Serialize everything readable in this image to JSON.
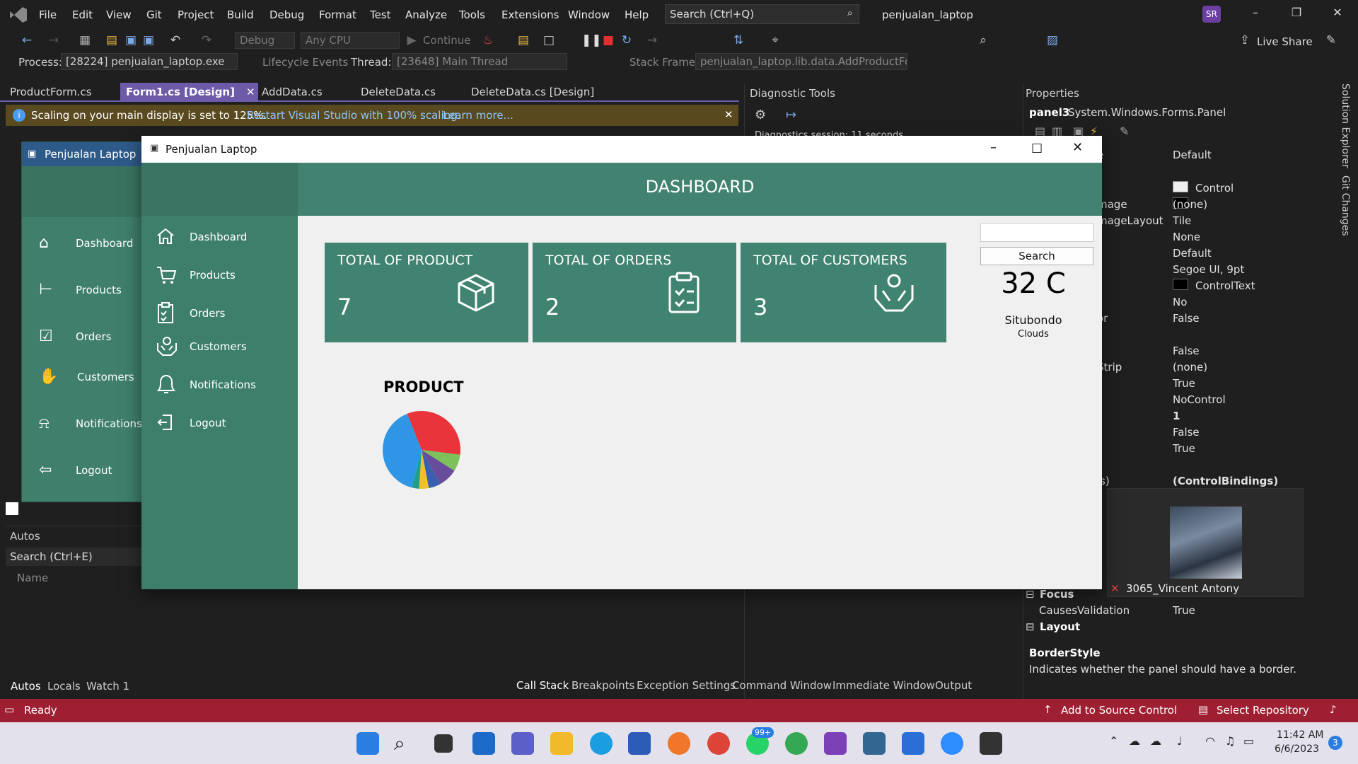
{
  "vs": {
    "menu": [
      "File",
      "Edit",
      "View",
      "Git",
      "Project",
      "Build",
      "Debug",
      "Format",
      "Test",
      "Analyze",
      "Tools",
      "Extensions",
      "Window",
      "Help"
    ],
    "search_placeholder": "Search (Ctrl+Q)",
    "project_title": "penjualan_laptop",
    "avatar_initials": "SR",
    "toolbar": {
      "config": "Debug",
      "platform": "Any CPU",
      "continue": "Continue",
      "live_share": "Live Share"
    },
    "process_bar": {
      "process_label": "Process:",
      "process_value": "[28224] penjualan_laptop.exe",
      "lifecycle": "Lifecycle Events",
      "thread_label": "Thread:",
      "thread_value": "[23648] Main Thread",
      "stack_label": "Stack Frame:",
      "stack_value": "penjualan_laptop.lib.data.AddProductForr"
    },
    "tabs": [
      "ProductForm.cs",
      "Form1.cs [Design]",
      "AddData.cs",
      "DeleteData.cs",
      "DeleteData.cs [Design]"
    ],
    "info_bar": {
      "message": "Scaling on your main display is set to 125%.",
      "link1": "Restart Visual Studio with 100% scaling.",
      "link2": "Learn more..."
    },
    "diagnostic": {
      "title": "Diagnostic Tools",
      "session": "Diagnostics session: 11 seconds"
    },
    "properties": {
      "title": "Properties",
      "object": "panel3",
      "type": "System.Windows.Forms.Panel",
      "rows": [
        {
          "name": "e",
          "value": "Default"
        },
        {
          "name": "",
          "value": "Control"
        },
        {
          "name": "mage",
          "value": "(none)"
        },
        {
          "name": "mageLayout",
          "value": "Tile"
        },
        {
          "name": "",
          "value": "None"
        },
        {
          "name": "",
          "value": "Default"
        },
        {
          "name": "",
          "value": "Segoe UI, 9pt"
        },
        {
          "name": "",
          "value": "ControlText"
        },
        {
          "name": "",
          "value": "No"
        },
        {
          "name": "or",
          "value": "False"
        },
        {
          "name": "",
          "value": "False"
        },
        {
          "name": "Strip",
          "value": "(none)"
        },
        {
          "name": "",
          "value": "True"
        },
        {
          "name": "",
          "value": "NoControl"
        },
        {
          "name": "",
          "value": "1"
        },
        {
          "name": "",
          "value": "False"
        },
        {
          "name": "",
          "value": "True"
        },
        {
          "name": "s)",
          "value": "(ControlBindings)"
        }
      ],
      "section_focus": "Focus",
      "causes_validation_label": "CausesValidation",
      "causes_validation_value": "True",
      "section_layout": "Layout",
      "help_title": "BorderStyle",
      "help_text": "Indicates whether the panel should have a border."
    },
    "side_tabs": [
      "Solution Explorer",
      "Git Changes"
    ],
    "autos": {
      "title": "Autos",
      "search": "Search (Ctrl+E)",
      "col_name": "Name",
      "bottom_tabs": [
        "Autos",
        "Locals",
        "Watch 1"
      ]
    },
    "bottom_tabs_right": [
      "Call Stack",
      "Breakpoints",
      "Exception Settings",
      "Command Window",
      "Immediate Window",
      "Output"
    ],
    "status": {
      "ready": "Ready",
      "source_control": "Add to Source Control",
      "repo": "Select Repository"
    },
    "zoom_tooltip_name": "3065_Vincent Antony"
  },
  "designer_form": {
    "title": "Penjualan Laptop",
    "nav": [
      "Dashboard",
      "Products",
      "Orders",
      "Customers",
      "Notifications",
      "Logout"
    ]
  },
  "app": {
    "title": "Penjualan Laptop",
    "nav": [
      "Dashboard",
      "Products",
      "Orders",
      "Customers",
      "Notifications",
      "Logout"
    ],
    "header": "DASHBOARD",
    "cards": [
      {
        "title": "TOTAL OF PRODUCT",
        "value": "7",
        "icon": "box-icon"
      },
      {
        "title": "TOTAL OF ORDERS",
        "value": "2",
        "icon": "clipboard-icon"
      },
      {
        "title": "TOTAL OF CUSTOMERS",
        "value": "3",
        "icon": "hands-icon"
      }
    ],
    "search_button": "Search",
    "weather": {
      "temperature": "32 C",
      "city": "Situbondo",
      "condition": "Clouds"
    },
    "chart_title": "PRODUCT"
  },
  "chart_data": {
    "type": "pie",
    "title": "PRODUCT",
    "values": [
      40,
      33,
      7,
      8,
      5,
      4,
      3
    ],
    "colors": [
      "#2f96e6",
      "#e8343a",
      "#7cc15a",
      "#6a4c9c",
      "#3a5fb0",
      "#f0c02a",
      "#1f9e8a"
    ]
  },
  "taskbar": {
    "time": "11:42 AM",
    "date": "6/6/2023",
    "badge": "99+",
    "notif_count": "3"
  }
}
